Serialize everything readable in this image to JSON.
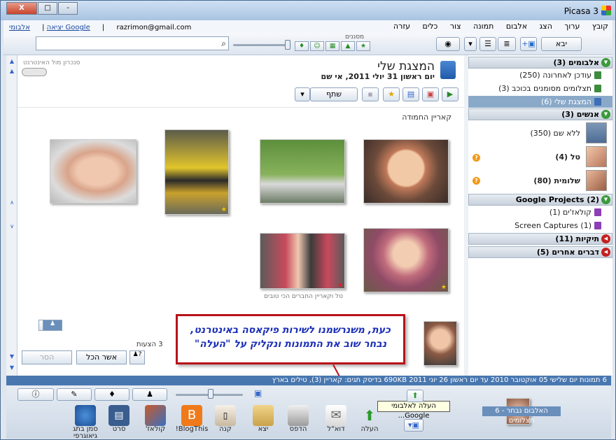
{
  "window": {
    "title": "Picasa 3",
    "controls": [
      "-",
      "□",
      "X"
    ]
  },
  "menu": {
    "items": [
      "קובץ",
      "ערוך",
      "הצג",
      "אלבום",
      "תמונה",
      "צור",
      "כלים",
      "עזרה"
    ],
    "account_email": "razrimon@gmail.com",
    "account_links": {
      "albums": "אלבומי Google",
      "sep": "|",
      "exit": "יציאה"
    }
  },
  "toolbar": {
    "import_label": "יבא",
    "filters_label": "מסננים",
    "search_placeholder": ""
  },
  "sidebar": {
    "groups": [
      {
        "title": "אלבומים (3)",
        "arrow": "▼"
      },
      {
        "title": "אנשים (3)",
        "arrow": "▼"
      },
      {
        "title": "Google Projects (2)",
        "arrow": "▼"
      },
      {
        "title": "תיקיות (11)",
        "arrow": "◀"
      },
      {
        "title": "דברים אחרים (5)",
        "arrow": "◀"
      }
    ],
    "albums": [
      "עודכן לאחרונה (250)",
      "תצלומים מסומנים בכוכב (3)",
      "המצגת שלי (6)"
    ],
    "people": [
      "ללא שם (350)",
      "טל (4)",
      "שלומית (80)"
    ],
    "projects": [
      "קולאז'ים (1)",
      "Screen Captures (1)"
    ],
    "question_mark": "?"
  },
  "album": {
    "title": "המצגת שלי",
    "date": "יום ראשון 31 יולי 2011, אי שם",
    "sync_label": "סנכרון מול האינטרנט",
    "share_label": "שתף",
    "caption_top": "קאריין החמודה",
    "caption_photo": "טל וקאריין החברים הכי טובים",
    "star_char": "★"
  },
  "suggestions": {
    "label": "3 הצעות",
    "confirm_all": "אשר הכל",
    "remove": "הסר"
  },
  "callout": {
    "line1": "כעת, משנרשמנו לשירות פיקאסה באינטרנט,",
    "line2": "נבחר שוב את התמונות ונקליק על \"העלה\""
  },
  "status": {
    "text": "6 תמונות    יום שלישי 05 אוקטובר 2010 עד יום ראשון 26 יוני 2011    690KB בדיסק    תגים: קאריין (3), טילים בארץ"
  },
  "bottom": {
    "tooltip": "העלה לאלבומי Google...",
    "tray_label": "האלבום נבחר - 6 תצלומים",
    "actions": [
      {
        "label": "העלה",
        "icon": "upload-icon"
      },
      {
        "label": "דוא\"ל",
        "icon": "email-icon"
      },
      {
        "label": "הדפס",
        "icon": "print-icon"
      },
      {
        "label": "יצא",
        "icon": "folder-icon"
      },
      {
        "label": "קנה",
        "icon": "shop-icon"
      },
      {
        "label": "BlogThis!",
        "icon": "blogger-icon"
      },
      {
        "label": "קולאז'",
        "icon": "collage-icon"
      },
      {
        "label": "סרט",
        "icon": "movie-icon"
      },
      {
        "label": "סמן בתג גיאוגרפי",
        "icon": "geotag-icon"
      }
    ]
  },
  "colors": {
    "accent": "#4877b0",
    "callout_border": "#b8121a",
    "callout_text": "#1b2fb8",
    "selected": "#8aa9c9"
  }
}
